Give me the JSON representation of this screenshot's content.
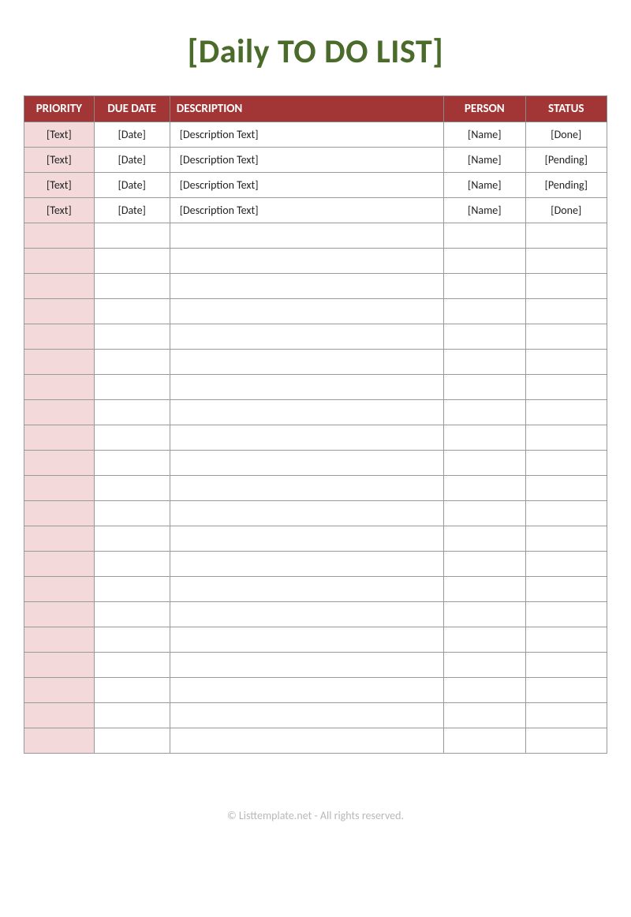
{
  "title": "[Daily TO DO LIST]",
  "columns": {
    "priority": "PRIORITY",
    "due_date": "DUE DATE",
    "description": "DESCRIPTION",
    "person": "PERSON",
    "status": "STATUS"
  },
  "rows": [
    {
      "priority": "[Text]",
      "due_date": "[Date]",
      "description": "[Description Text]",
      "person": "[Name]",
      "status": "[Done]"
    },
    {
      "priority": "[Text]",
      "due_date": "[Date]",
      "description": "[Description Text]",
      "person": "[Name]",
      "status": "[Pending]"
    },
    {
      "priority": "[Text]",
      "due_date": "[Date]",
      "description": "[Description Text]",
      "person": "[Name]",
      "status": "[Pending]"
    },
    {
      "priority": "[Text]",
      "due_date": "[Date]",
      "description": "[Description Text]",
      "person": "[Name]",
      "status": "[Done]"
    }
  ],
  "empty_row_count": 21,
  "footer": "© Listtemplate.net - All rights reserved."
}
